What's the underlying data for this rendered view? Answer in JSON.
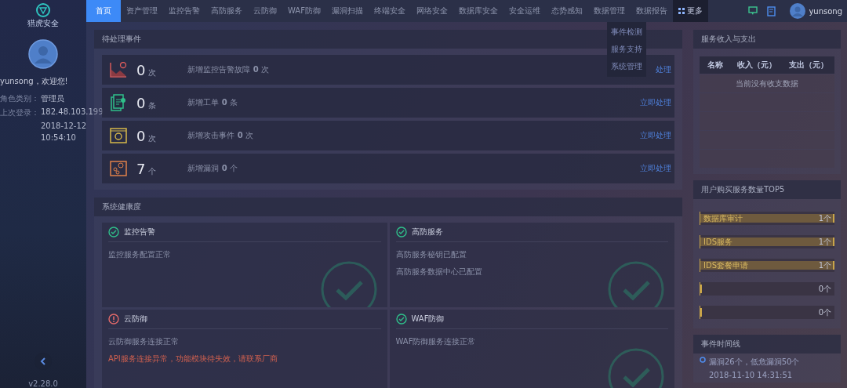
{
  "logo": {
    "text": "猎虎安全"
  },
  "user_panel": {
    "greeting": "yunsong，欢迎您!",
    "info": [
      {
        "label": "角色类别：",
        "value": "管理员"
      },
      {
        "label": "上次登录：",
        "value": "182.48.103.199"
      },
      {
        "value": "2018-12-12"
      },
      {
        "value": "10:54:10"
      }
    ],
    "version": "v2.28.0"
  },
  "nav": {
    "items": [
      {
        "label": "首页",
        "selected": true
      },
      {
        "label": "资产管理",
        "selected": false
      },
      {
        "label": "监控告警",
        "selected": false
      },
      {
        "label": "高防服务",
        "selected": false
      },
      {
        "label": "云防御",
        "selected": false
      },
      {
        "label": "WAF防御",
        "selected": false
      },
      {
        "label": "漏洞扫描",
        "selected": false
      },
      {
        "label": "终端安全",
        "selected": false
      },
      {
        "label": "网络安全",
        "selected": false
      },
      {
        "label": "数据库安全",
        "selected": false
      },
      {
        "label": "安全运维",
        "selected": false
      },
      {
        "label": "态势感知",
        "selected": false
      },
      {
        "label": "数据管理",
        "selected": false
      },
      {
        "label": "数据报告",
        "selected": false
      }
    ],
    "more": {
      "label": "更多",
      "expanded": true,
      "menu": [
        "事件检测",
        "服务支持",
        "系统管理"
      ]
    },
    "username": "yunsong"
  },
  "pending": {
    "title": "待处理事件",
    "rows": [
      {
        "kind": "alarm",
        "count": "0",
        "unit": "次",
        "text": "新增监控告警故障 **0** 次",
        "action": "处理"
      },
      {
        "kind": "ticket",
        "count": "0",
        "unit": "条",
        "text": "新增工单 **0** 条",
        "action": "立即处理"
      },
      {
        "kind": "attack",
        "count": "0",
        "unit": "次",
        "text": "新增攻击事件 **0** 次",
        "action": "立即处理"
      },
      {
        "kind": "vuln",
        "count": "7",
        "unit": "个",
        "text": "新增漏洞 **0** 个",
        "action": "立即处理"
      }
    ]
  },
  "health": {
    "title": "系统健康度",
    "cards": [
      {
        "title": "监控告警",
        "ok": true,
        "lines": [
          {
            "kind": "normal",
            "text": "监控服务配置正常"
          }
        ]
      },
      {
        "title": "高防服务",
        "ok": true,
        "lines": [
          {
            "kind": "normal",
            "text": "高防服务秘钥已配置"
          },
          {
            "kind": "normal",
            "text": "高防服务数据中心已配置"
          }
        ]
      },
      {
        "title": "云防御",
        "ok": false,
        "lines": [
          {
            "kind": "normal",
            "text": "云防御服务连接正常"
          },
          {
            "kind": "error",
            "text": "API服务连接异常，功能模块待失效，请联系厂商"
          }
        ]
      },
      {
        "title": "WAF防御",
        "ok": true,
        "lines": [
          {
            "kind": "normal",
            "text": "WAF防御服务连接正常"
          }
        ]
      }
    ]
  },
  "finance": {
    "title": "服务收入与支出",
    "columns": [
      "名称",
      "收入（元）",
      "支出（元）"
    ],
    "empty_message": "当前没有收支数据"
  },
  "top5": {
    "title": "用户购买服务数量TOP5",
    "items": [
      {
        "name": "数据库审计",
        "value": "1个",
        "level": 1
      },
      {
        "name": "IDS服务",
        "value": "1个",
        "level": 1
      },
      {
        "name": "IDS套餐申请",
        "value": "1个",
        "level": 1
      },
      {
        "value": "0个",
        "level": 0
      },
      {
        "value": "0个",
        "level": 0
      }
    ]
  },
  "timeline": {
    "title": "事件时间线",
    "items": [
      {
        "text": "漏洞26个，低危漏洞50个",
        "time": "2018-11-10 14:31:51"
      }
    ]
  }
}
